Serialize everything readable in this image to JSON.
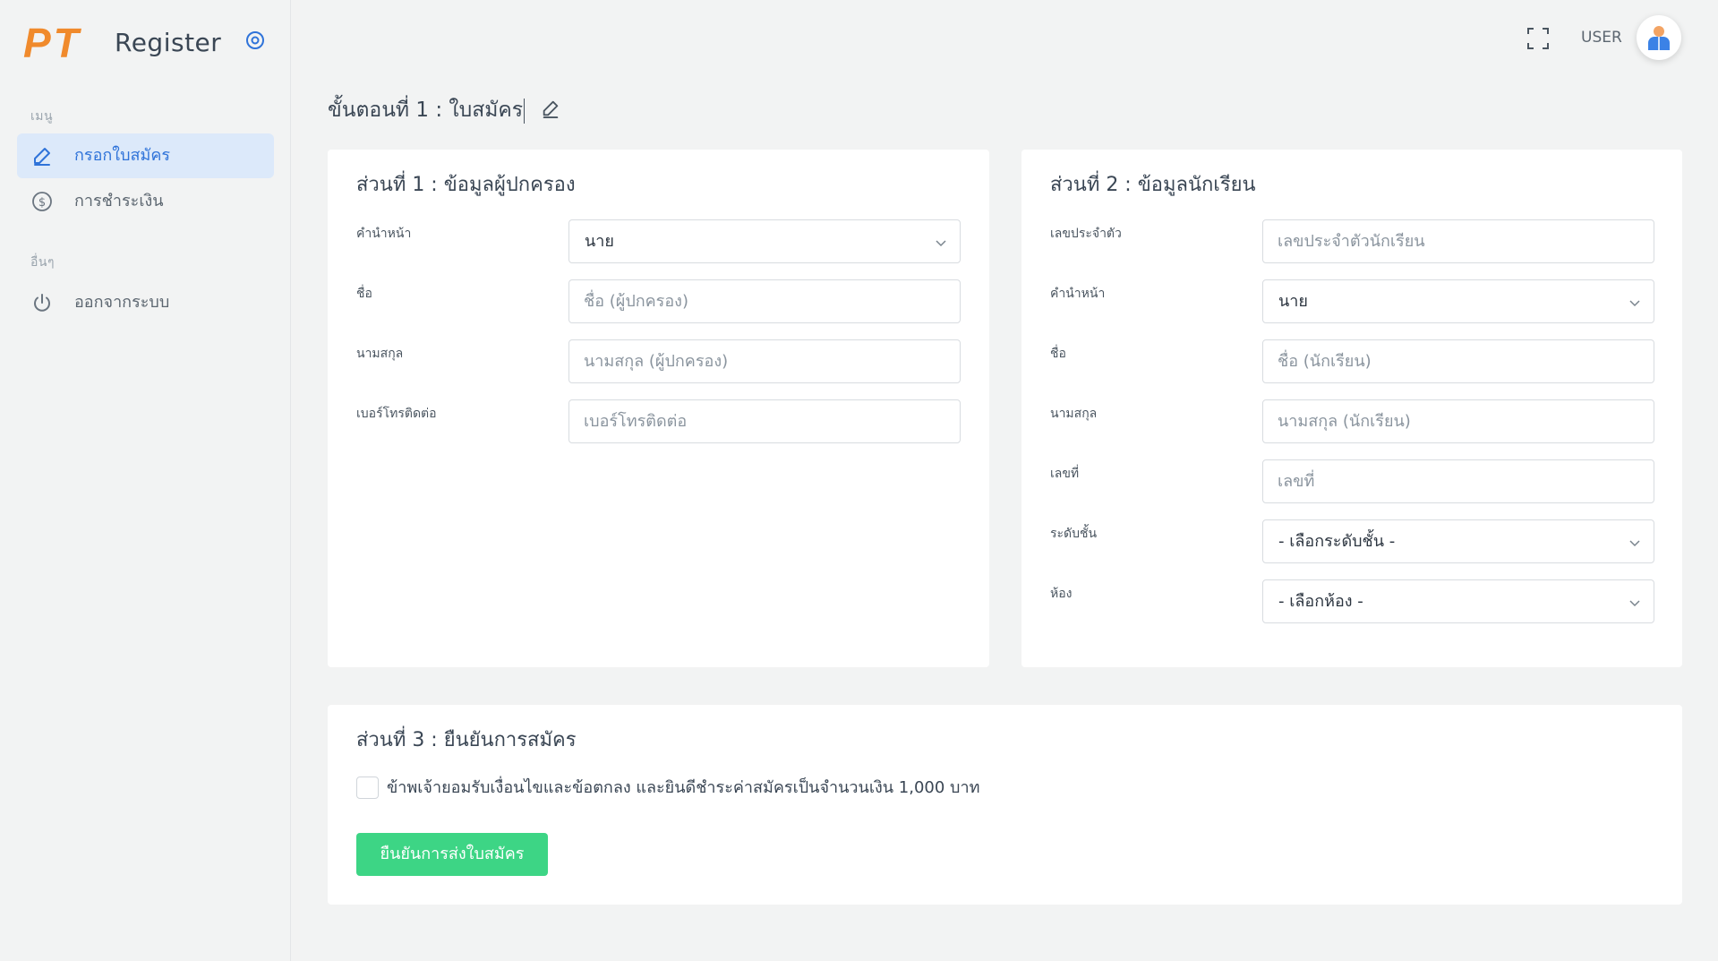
{
  "sidebar": {
    "logo_text": "PT",
    "brand": "Register",
    "menu_label": "เมนู",
    "other_label": "อื่นๆ",
    "items": [
      {
        "label": "กรอกใบสมัคร",
        "icon": "pencil-icon",
        "active": true
      },
      {
        "label": "การชำระเงิน",
        "icon": "dollar-circle-icon",
        "active": false
      },
      {
        "label": "ออกจากระบบ",
        "icon": "power-icon",
        "active": false
      }
    ]
  },
  "header": {
    "user_label": "USER"
  },
  "page": {
    "title": "ขั้นตอนที่ 1 : ใบสมัคร"
  },
  "section1": {
    "title": "ส่วนที่ 1 : ข้อมูลผู้ปกครอง",
    "fields": [
      {
        "label": "คำนำหน้า",
        "type": "select",
        "value": "นาย"
      },
      {
        "label": "ชื่อ",
        "type": "text",
        "placeholder": "ชื่อ (ผู้ปกครอง)"
      },
      {
        "label": "นามสกุล",
        "type": "text",
        "placeholder": "นามสกุล (ผู้ปกครอง)"
      },
      {
        "label": "เบอร์โทรติดต่อ",
        "type": "text",
        "placeholder": "เบอร์โทรติดต่อ"
      }
    ]
  },
  "section2": {
    "title": "ส่วนที่ 2 : ข้อมูลนักเรียน",
    "fields": [
      {
        "label": "เลขประจำตัว",
        "type": "text",
        "placeholder": "เลขประจำตัวนักเรียน"
      },
      {
        "label": "คำนำหน้า",
        "type": "select",
        "value": "นาย"
      },
      {
        "label": "ชื่อ",
        "type": "text",
        "placeholder": "ชื่อ (นักเรียน)"
      },
      {
        "label": "นามสกุล",
        "type": "text",
        "placeholder": "นามสกุล (นักเรียน)"
      },
      {
        "label": "เลขที่",
        "type": "text",
        "placeholder": "เลขที่"
      },
      {
        "label": "ระดับชั้น",
        "type": "select",
        "value": "- เลือกระดับชั้น -"
      },
      {
        "label": "ห้อง",
        "type": "select",
        "value": "- เลือกห้อง -"
      }
    ]
  },
  "section3": {
    "title": "ส่วนที่ 3 : ยืนยันการสมัคร",
    "agree_text": "ข้าพเจ้ายอมรับเงื่อนไขและข้อตกลง และยินดีชำระค่าสมัครเป็นจำนวนเงิน 1,000 บาท",
    "submit_label": "ยืนยันการส่งใบสมัคร"
  },
  "colors": {
    "accent": "#2f73d9",
    "logo": "#f08a2c",
    "submit": "#3dd585",
    "active_bg": "#dce9fa"
  }
}
